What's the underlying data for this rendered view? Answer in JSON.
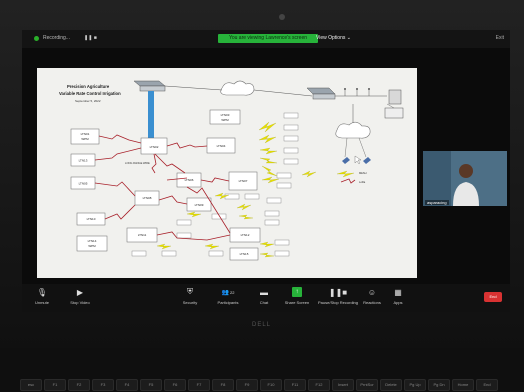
{
  "window": {
    "recording_label": "Recording...",
    "share_banner": "You are viewing Lawrence's screen",
    "view_options": "View Options ⌄",
    "exit_label": "Exit"
  },
  "slide": {
    "title_line1": "Precision Agriculture",
    "title_line2": "Variable Rate Control Irrigation",
    "date": "September 5, 2022",
    "boxes": {
      "lt01": "LTN01",
      "lt02": "LTN02",
      "lt03": "LTN03",
      "lt04": "LTN04",
      "lt05": "LTN05",
      "lt06": "LTN06",
      "lt07": "LTN07",
      "lt08": "LTN08",
      "lt09": "LTN09",
      "lt10": "LTN10",
      "lt11": "LTN11",
      "lt12": "LTN12",
      "lt13": "LTN13",
      "lt14": "LTN14",
      "wpm_top": "LTN03\nWPM",
      "wpm_left": "LTN01\nWPM",
      "wpm_bot": "LTN14\nWPM"
    },
    "labels": {
      "long_link": "LONG RANGE WIRE",
      "mesh": "MESH",
      "lora": "LoRa"
    }
  },
  "participant": {
    "name": "asparacing"
  },
  "toolbar": {
    "unmute": "Unmute",
    "stop_video": "Stop Video",
    "security": "Security",
    "participants": "Participants",
    "participants_count": "22",
    "chat": "Chat",
    "share_screen": "Share Screen",
    "pause_recording": "Pause/Stop Recording",
    "reactions": "Reactions",
    "apps": "Apps",
    "end": "End"
  },
  "laptop": {
    "brand": "DELL",
    "keys": [
      "esc",
      "F1",
      "F2",
      "F3",
      "F4",
      "F5",
      "F6",
      "F7",
      "F8",
      "F9",
      "F10",
      "F11",
      "F12",
      "Insert",
      "PrntScr",
      "Delete",
      "Pg Up",
      "Pg Dn",
      "Home",
      "End"
    ]
  },
  "colors": {
    "share_green": "#27b33a",
    "end_red": "#d83232",
    "link_red": "#a8202a",
    "wireless_yellow": "#e8e000",
    "slide_bg": "#f1f1ee"
  }
}
